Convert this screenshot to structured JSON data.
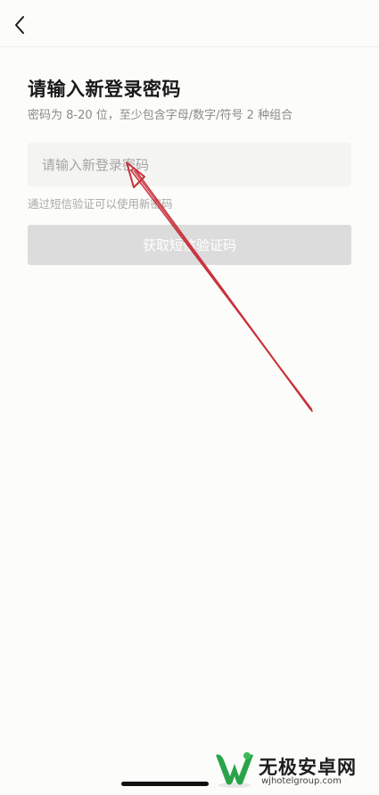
{
  "header": {
    "back_icon": "chevron-left-icon"
  },
  "form": {
    "title": "请输入新登录密码",
    "subtitle": "密码为 8-20 位，至少包含字母/数字/符号 2 种组合",
    "password_placeholder": "请输入新登录密码",
    "password_value": "",
    "hint": "通过短信验证可以使用新密码",
    "sms_button_label": "获取短信验证码"
  },
  "watermark": {
    "site_name": "无极安卓网",
    "url": "wjhotelgroup.com"
  },
  "colors": {
    "background": "#fcfcfa",
    "input_background": "#f4f4f2",
    "button_disabled": "#dcdcdc",
    "annotation_arrow": "#c8323c",
    "logo_green": "#2aa34a"
  }
}
